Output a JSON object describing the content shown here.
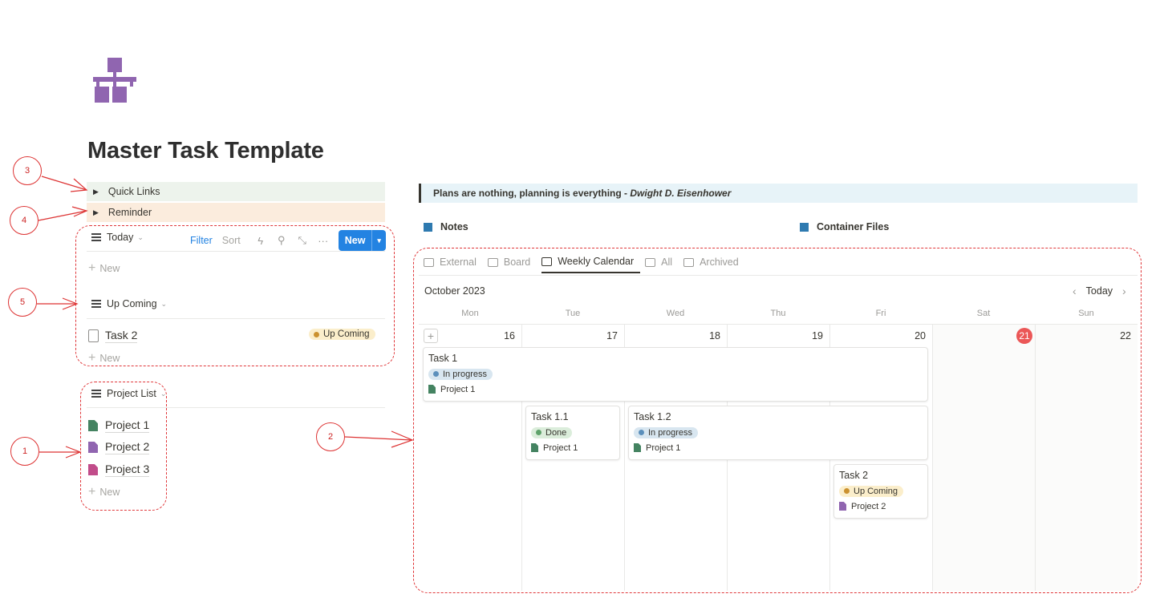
{
  "page": {
    "icon": "org-chart-icon",
    "title": "Master Task Template"
  },
  "toggles": {
    "quick_links": "Quick Links",
    "reminder": "Reminder"
  },
  "today_view": {
    "title": "Today",
    "filter": "Filter",
    "sort": "Sort",
    "new_button": "New",
    "new_row": "New"
  },
  "upcoming_view": {
    "title": "Up Coming",
    "rows": [
      {
        "title": "Task 2",
        "status": "Up Coming"
      }
    ],
    "new_row": "New"
  },
  "project_list": {
    "title": "Project List",
    "items": [
      {
        "title": "Project 1",
        "color": "#448361"
      },
      {
        "title": "Project 2",
        "color": "#9065b0"
      },
      {
        "title": "Project 3",
        "color": "#c14c8a"
      }
    ],
    "new_row": "New"
  },
  "quote": {
    "text": "Plans are nothing, planning is everything - ",
    "author": "Dwight D. Eisenhower"
  },
  "links": {
    "notes": "Notes",
    "container_files": "Container Files"
  },
  "calendar": {
    "tabs": [
      "External",
      "Board",
      "Weekly Calendar",
      "All",
      "Archived"
    ],
    "active_tab": "Weekly Calendar",
    "month": "October 2023",
    "today_button": "Today",
    "weekdays": [
      "Mon",
      "Tue",
      "Wed",
      "Thu",
      "Fri",
      "Sat",
      "Sun"
    ],
    "days": [
      "16",
      "17",
      "18",
      "19",
      "20",
      "21",
      "22"
    ],
    "today": "21",
    "cards": [
      {
        "title": "Task 1",
        "status": "In progress",
        "project": "Project 1"
      },
      {
        "title": "Task 1.1",
        "status": "Done",
        "project": "Project 1"
      },
      {
        "title": "Task 1.2",
        "status": "In progress",
        "project": "Project 1"
      },
      {
        "title": "Task 2",
        "status": "Up Coming",
        "project": "Project 2"
      }
    ]
  },
  "annotations": [
    "1",
    "2",
    "3",
    "4",
    "5"
  ],
  "colors": {
    "accent": "#2383e2",
    "annotation": "#e0373a",
    "today_marker": "#eb5757",
    "quick_links_bg": "#edf3ec",
    "reminder_bg": "#fbecdd",
    "quote_bg": "#e7f3f8"
  }
}
